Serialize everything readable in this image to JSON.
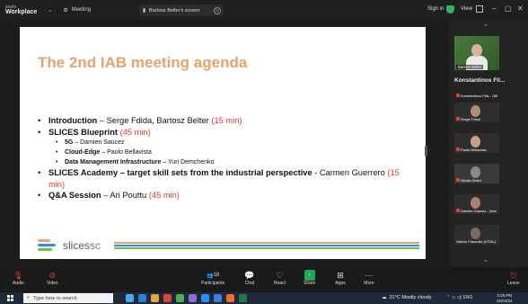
{
  "titlebar": {
    "app_line1": "zoom",
    "app_line2": "Workplace",
    "meeting_label": "Meeting",
    "share_label": "Bartosz Belter's screen",
    "signin_label": "Sign in",
    "view_label": "View"
  },
  "slide": {
    "title": "The 2nd IAB meeting agenda",
    "items": [
      {
        "bold": "Introduction",
        "rest": " – Serge Fdida, Bartosz Belter ",
        "time": "(15 min)"
      },
      {
        "bold": "SLICES Blueprint",
        "rest": " ",
        "time": "(45 min)"
      },
      {
        "bold": "SLICES Academy – target skill sets from the industrial perspective",
        "rest": " - Carmen Guerrero ",
        "time": "(15 min)"
      },
      {
        "bold": "Q&A Session",
        "rest": " – Ari Pouttu ",
        "time": "(45 min)"
      }
    ],
    "subitems": [
      {
        "bold": "5G",
        "rest": " – Damien Saucez"
      },
      {
        "bold": "Cloud-Edge",
        "rest": " – Paolo Bellavista"
      },
      {
        "bold": "Data Management Infrastructure",
        "rest": " – Yuri Demchenko"
      }
    ],
    "brand_text": "slices",
    "brand_suffix": "sc"
  },
  "panel": {
    "self_label": "Bartosz Belter",
    "speaker_name": "Konstantinos Fil...",
    "tiles": [
      {
        "label": "Konstantinos Filis - Offi",
        "face": "#c9a78d"
      },
      {
        "label": "Serge Fdida",
        "face": "#b58b74"
      },
      {
        "label": "Paolo Bellavista",
        "face": "#c59f86"
      },
      {
        "label": "Nicola Orsini",
        "face": "#8a8a8a"
      },
      {
        "label": "Damien Saucez - Inria",
        "face": "#a8826a"
      },
      {
        "label": "Valerio Frascolla (VITAL)",
        "face": "#7b6a5e"
      }
    ]
  },
  "toolbar": {
    "audio": "Audio",
    "video": "Video",
    "participants": "Participants",
    "participants_count": "18",
    "chat": "Chat",
    "react": "React",
    "share": "Share",
    "apps": "Apps",
    "more": "More",
    "leave": "Leave"
  },
  "taskbar": {
    "search_placeholder": "Type here to search",
    "weather": "21°C  Mostly cloudy",
    "lang": "ENG",
    "time": "3:15 PM",
    "date": "22/04/24"
  },
  "colors": {
    "title_accent": "#e9a26a",
    "time_red": "#d9382f",
    "zoom_green": "#1fa855",
    "leave_red": "#e0433c"
  }
}
